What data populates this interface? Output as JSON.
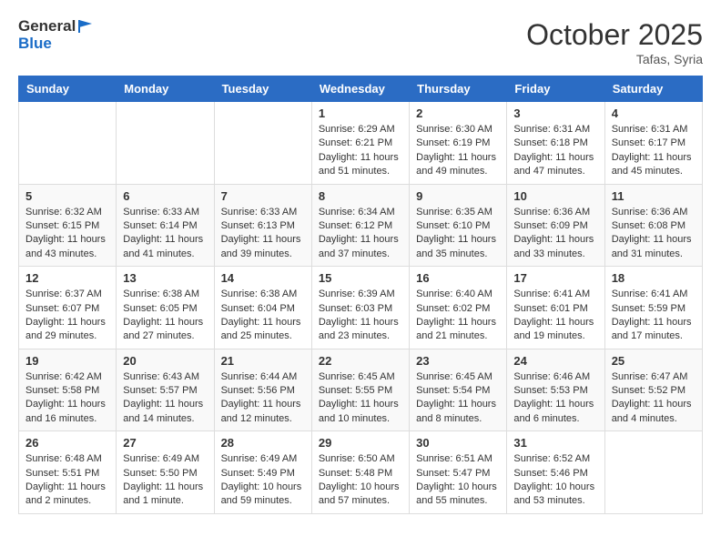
{
  "header": {
    "logo_general": "General",
    "logo_blue": "Blue",
    "month": "October 2025",
    "location": "Tafas, Syria"
  },
  "weekdays": [
    "Sunday",
    "Monday",
    "Tuesday",
    "Wednesday",
    "Thursday",
    "Friday",
    "Saturday"
  ],
  "weeks": [
    [
      {
        "day": "",
        "info": ""
      },
      {
        "day": "",
        "info": ""
      },
      {
        "day": "",
        "info": ""
      },
      {
        "day": "1",
        "info": "Sunrise: 6:29 AM\nSunset: 6:21 PM\nDaylight: 11 hours\nand 51 minutes."
      },
      {
        "day": "2",
        "info": "Sunrise: 6:30 AM\nSunset: 6:19 PM\nDaylight: 11 hours\nand 49 minutes."
      },
      {
        "day": "3",
        "info": "Sunrise: 6:31 AM\nSunset: 6:18 PM\nDaylight: 11 hours\nand 47 minutes."
      },
      {
        "day": "4",
        "info": "Sunrise: 6:31 AM\nSunset: 6:17 PM\nDaylight: 11 hours\nand 45 minutes."
      }
    ],
    [
      {
        "day": "5",
        "info": "Sunrise: 6:32 AM\nSunset: 6:15 PM\nDaylight: 11 hours\nand 43 minutes."
      },
      {
        "day": "6",
        "info": "Sunrise: 6:33 AM\nSunset: 6:14 PM\nDaylight: 11 hours\nand 41 minutes."
      },
      {
        "day": "7",
        "info": "Sunrise: 6:33 AM\nSunset: 6:13 PM\nDaylight: 11 hours\nand 39 minutes."
      },
      {
        "day": "8",
        "info": "Sunrise: 6:34 AM\nSunset: 6:12 PM\nDaylight: 11 hours\nand 37 minutes."
      },
      {
        "day": "9",
        "info": "Sunrise: 6:35 AM\nSunset: 6:10 PM\nDaylight: 11 hours\nand 35 minutes."
      },
      {
        "day": "10",
        "info": "Sunrise: 6:36 AM\nSunset: 6:09 PM\nDaylight: 11 hours\nand 33 minutes."
      },
      {
        "day": "11",
        "info": "Sunrise: 6:36 AM\nSunset: 6:08 PM\nDaylight: 11 hours\nand 31 minutes."
      }
    ],
    [
      {
        "day": "12",
        "info": "Sunrise: 6:37 AM\nSunset: 6:07 PM\nDaylight: 11 hours\nand 29 minutes."
      },
      {
        "day": "13",
        "info": "Sunrise: 6:38 AM\nSunset: 6:05 PM\nDaylight: 11 hours\nand 27 minutes."
      },
      {
        "day": "14",
        "info": "Sunrise: 6:38 AM\nSunset: 6:04 PM\nDaylight: 11 hours\nand 25 minutes."
      },
      {
        "day": "15",
        "info": "Sunrise: 6:39 AM\nSunset: 6:03 PM\nDaylight: 11 hours\nand 23 minutes."
      },
      {
        "day": "16",
        "info": "Sunrise: 6:40 AM\nSunset: 6:02 PM\nDaylight: 11 hours\nand 21 minutes."
      },
      {
        "day": "17",
        "info": "Sunrise: 6:41 AM\nSunset: 6:01 PM\nDaylight: 11 hours\nand 19 minutes."
      },
      {
        "day": "18",
        "info": "Sunrise: 6:41 AM\nSunset: 5:59 PM\nDaylight: 11 hours\nand 17 minutes."
      }
    ],
    [
      {
        "day": "19",
        "info": "Sunrise: 6:42 AM\nSunset: 5:58 PM\nDaylight: 11 hours\nand 16 minutes."
      },
      {
        "day": "20",
        "info": "Sunrise: 6:43 AM\nSunset: 5:57 PM\nDaylight: 11 hours\nand 14 minutes."
      },
      {
        "day": "21",
        "info": "Sunrise: 6:44 AM\nSunset: 5:56 PM\nDaylight: 11 hours\nand 12 minutes."
      },
      {
        "day": "22",
        "info": "Sunrise: 6:45 AM\nSunset: 5:55 PM\nDaylight: 11 hours\nand 10 minutes."
      },
      {
        "day": "23",
        "info": "Sunrise: 6:45 AM\nSunset: 5:54 PM\nDaylight: 11 hours\nand 8 minutes."
      },
      {
        "day": "24",
        "info": "Sunrise: 6:46 AM\nSunset: 5:53 PM\nDaylight: 11 hours\nand 6 minutes."
      },
      {
        "day": "25",
        "info": "Sunrise: 6:47 AM\nSunset: 5:52 PM\nDaylight: 11 hours\nand 4 minutes."
      }
    ],
    [
      {
        "day": "26",
        "info": "Sunrise: 6:48 AM\nSunset: 5:51 PM\nDaylight: 11 hours\nand 2 minutes."
      },
      {
        "day": "27",
        "info": "Sunrise: 6:49 AM\nSunset: 5:50 PM\nDaylight: 11 hours\nand 1 minute."
      },
      {
        "day": "28",
        "info": "Sunrise: 6:49 AM\nSunset: 5:49 PM\nDaylight: 10 hours\nand 59 minutes."
      },
      {
        "day": "29",
        "info": "Sunrise: 6:50 AM\nSunset: 5:48 PM\nDaylight: 10 hours\nand 57 minutes."
      },
      {
        "day": "30",
        "info": "Sunrise: 6:51 AM\nSunset: 5:47 PM\nDaylight: 10 hours\nand 55 minutes."
      },
      {
        "day": "31",
        "info": "Sunrise: 6:52 AM\nSunset: 5:46 PM\nDaylight: 10 hours\nand 53 minutes."
      },
      {
        "day": "",
        "info": ""
      }
    ]
  ]
}
